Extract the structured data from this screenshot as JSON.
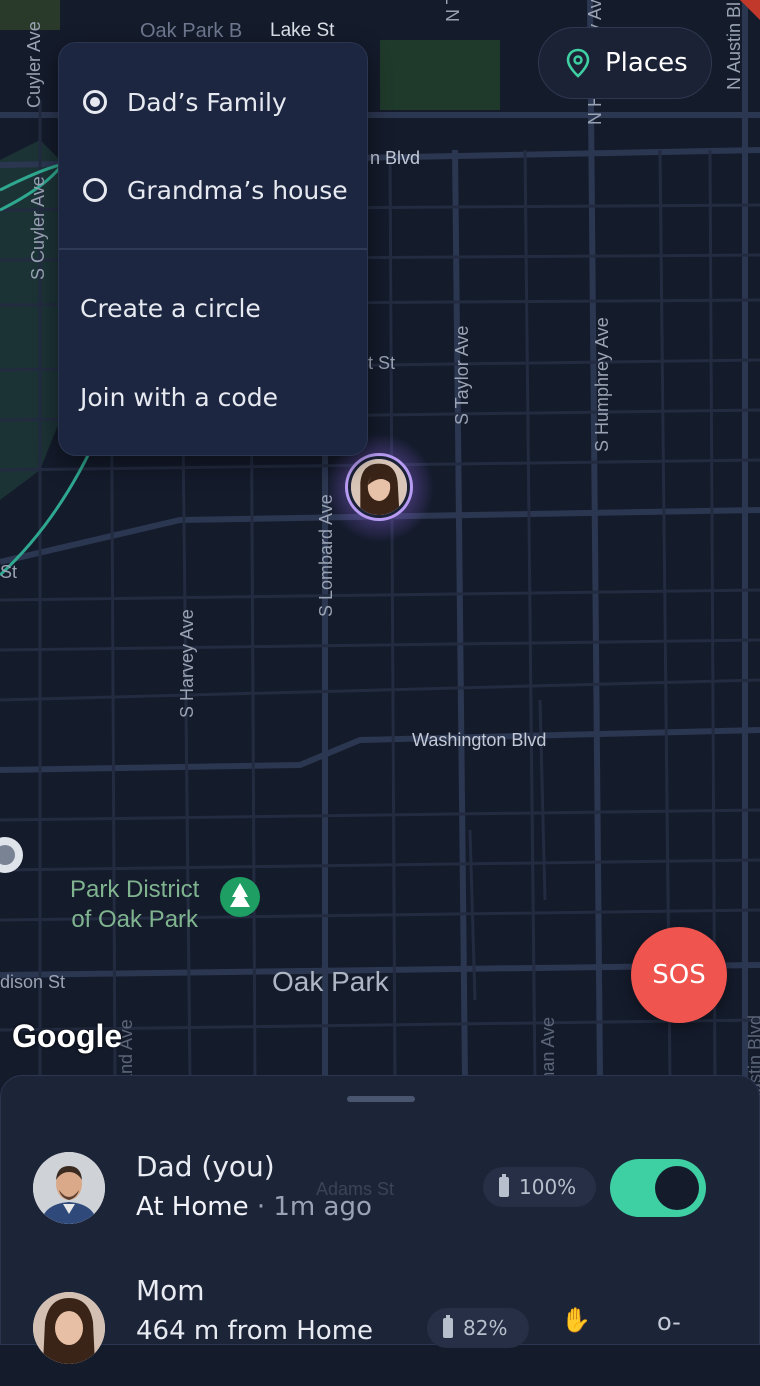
{
  "circle_menu": {
    "circles": [
      {
        "label": "Dad’s Family",
        "selected": true
      },
      {
        "label": "Grandma’s house",
        "selected": false
      }
    ],
    "actions": [
      "Create a circle",
      "Join with a code"
    ]
  },
  "places_button": {
    "label": "Places",
    "icon": "map-pin-icon"
  },
  "map": {
    "labels": {
      "oak_park_blvd_top": "Oak Park B",
      "lake_st": "Lake St",
      "n_taylor": "N T",
      "n_humphrey": "N Humphrey Av",
      "n_austin": "N Austin Bl",
      "cuyler_top": "Cuyler Ave",
      "s_cuyler": "S Cuyler Ave",
      "blvd_partial": "n Blvd",
      "st_partial": "t St",
      "s_taylor": "S Taylor Ave",
      "s_humphrey": "S Humphrey Ave",
      "s_lombard": "S Lombard Ave",
      "s_harvey": "S Harvey Ave",
      "st_left": "St",
      "washington": "Washington Blvd",
      "park_district": "Park District\nof Oak Park",
      "madison": "dison St",
      "oak_park": "Oak Park",
      "highland": "Highland Ave",
      "lyman": "Lyman Ave",
      "austin_bottom": "Austin Blvd",
      "adams": "Adams St"
    },
    "google": "Google"
  },
  "sos_button": {
    "label": "SOS"
  },
  "members": [
    {
      "name": "Dad (you)",
      "place": "At Home",
      "time": " · 1m ago",
      "battery": "100%",
      "sharing": true
    },
    {
      "name": "Mom",
      "place": "464 m from Home",
      "time": "",
      "battery": "82%"
    }
  ],
  "colors": {
    "accent": "#3ecfa3",
    "sos": "#f0544f",
    "avatar_ring": "#b89cf4"
  }
}
